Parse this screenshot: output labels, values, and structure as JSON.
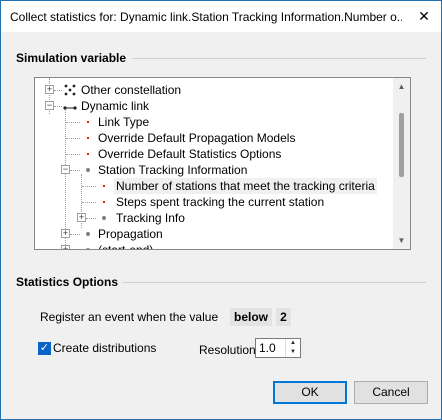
{
  "window": {
    "title": "Collect statistics for: Dynamic link.Station Tracking Information.Number o..."
  },
  "simulation_variable": {
    "header": "Simulation variable",
    "tree": {
      "items": [
        {
          "label": "Other constellation"
        },
        {
          "label": "Dynamic link"
        },
        {
          "label": "Link Type"
        },
        {
          "label": "Override Default Propagation Models"
        },
        {
          "label": "Override Default Statistics Options"
        },
        {
          "label": "Station Tracking Information"
        },
        {
          "label": "Number of stations that meet the tracking criteria",
          "selected": true
        },
        {
          "label": "Steps spent tracking the current station"
        },
        {
          "label": "Tracking Info"
        },
        {
          "label": "Propagation"
        },
        {
          "label": "(start-end)"
        }
      ]
    }
  },
  "statistics_options": {
    "header": "Statistics Options",
    "register_label": "Register an event when the value",
    "register_condition": "below",
    "register_value": "2",
    "create_distributions_label": "Create distributions",
    "create_distributions_checked": true,
    "resolution_label": "Resolution:",
    "resolution_value": "1.0"
  },
  "buttons": {
    "ok": "OK",
    "cancel": "Cancel"
  },
  "colors": {
    "accent": "#0078d7",
    "checkbox": "#0a64c8",
    "bullet_red": "#dd2211"
  }
}
